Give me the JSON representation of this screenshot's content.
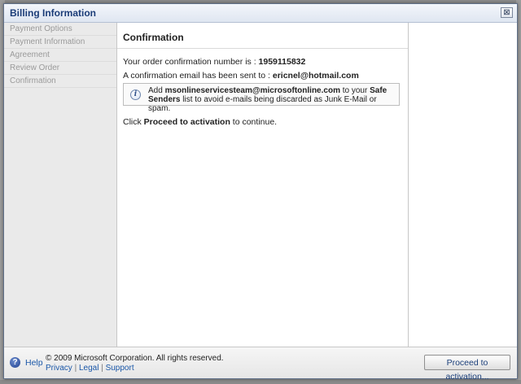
{
  "dialog": {
    "title": "Billing Information",
    "close_glyph": "⊠"
  },
  "sidebar": {
    "items": [
      {
        "label": "Payment Options"
      },
      {
        "label": "Payment Information"
      },
      {
        "label": "Agreement"
      },
      {
        "label": "Review Order"
      },
      {
        "label": "Confirmation"
      }
    ]
  },
  "main": {
    "title": "Confirmation",
    "order_prefix": "Your order confirmation number is : ",
    "order_number": "1959115832",
    "email_prefix": "A confirmation email has been sent to : ",
    "email_address": "ericnel@hotmail.com",
    "info": {
      "icon": "info-icon",
      "prefix": "Add ",
      "sender": "msonlineservicesteam@microsoftonline.com",
      "middle": " to your ",
      "safe_senders": "Safe Senders",
      "suffix": " list to avoid e-mails being discarded as Junk E-Mail or spam."
    },
    "instruction_prefix": "Click ",
    "instruction_action": "Proceed to activation",
    "instruction_suffix": " to continue."
  },
  "footer": {
    "help_label": "Help",
    "copyright": "© 2009 Microsoft Corporation. All rights reserved.",
    "links": [
      "Privacy",
      "Legal",
      "Support"
    ],
    "separator": " | ",
    "proceed_button": "Proceed to activation..."
  }
}
